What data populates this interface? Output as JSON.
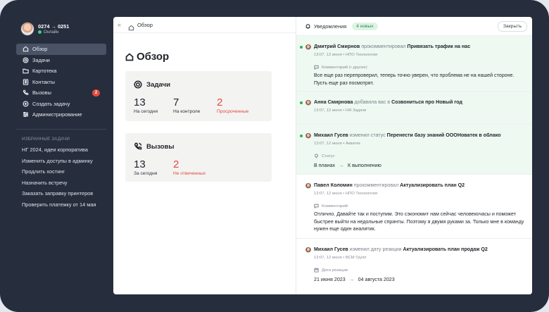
{
  "user": {
    "name": "0274 → 0251",
    "status": "Онлайн"
  },
  "nav": [
    {
      "label": "Обзор",
      "icon": "home-icon",
      "active": true
    },
    {
      "label": "Задачи",
      "icon": "target-icon"
    },
    {
      "label": "Картотека",
      "icon": "folder-icon"
    },
    {
      "label": "Контакты",
      "icon": "contacts-icon"
    },
    {
      "label": "Вызовы",
      "icon": "phone-icon",
      "badge": "2"
    },
    {
      "label": "Создать задачу",
      "icon": "plus-circle-icon"
    },
    {
      "label": "Администрирование",
      "icon": "sliders-icon"
    }
  ],
  "favorites": {
    "title": "ИЗБРАННЫЕ ЗАДАЧИ",
    "items": [
      "НГ 2024, идеи корпоратива",
      "Изменить доступы в админку",
      "Продлить хостинг",
      "Назначить встречу",
      "Заказать заправку принтеров",
      "Проверить платежку от 14 мая"
    ]
  },
  "breadcrumb": {
    "collapse": "«",
    "label": "Обзор"
  },
  "page": {
    "title": "Обзор"
  },
  "tasks": {
    "title": "Задачи",
    "stats": [
      {
        "value": "13",
        "label": "На сегодня"
      },
      {
        "value": "7",
        "label": "На контроле"
      },
      {
        "value": "2",
        "label": "Просроченные"
      }
    ]
  },
  "calls": {
    "title": "Вызовы",
    "stats": [
      {
        "value": "13",
        "label": "За сегодня"
      },
      {
        "value": "2",
        "label": "Не отвеченных"
      }
    ]
  },
  "notifications": {
    "title": "Уведомления",
    "new_badge": "4 новых",
    "close": "Закрыть",
    "items": [
      {
        "actor": "Дмитрий Смирнов",
        "verb": "прокомментировал",
        "target": "Привязать трафик на нас",
        "meta": "13:07, 12 июня • НПО Технология",
        "sub_label": "Комментарий (• другие)",
        "text": "Все еще раз перепроверил, теперь точно уверен, что проблема не на нашей стороне. Пусть еще раз посмотрят."
      },
      {
        "actor": "Анна Смирнова",
        "verb": "добавила вас в",
        "target": "Созвониться про Новый год",
        "meta": "13:07, 12 июня • НЯ Задачи"
      },
      {
        "actor": "Михаил Гусев",
        "verb": "изменил статус",
        "target": "Перенести базу знаний ОООНоватек в облако",
        "meta": "13:07, 12 июня • Акватек",
        "sub_label": "Статус",
        "from": "В планах",
        "to": "К выполнению"
      },
      {
        "actor": "Павел Коломин",
        "verb": "прокомментировал",
        "target": "Актуализировать план Q2",
        "meta": "13:07, 12 июня • НПО Технология",
        "sub_label": "Комментарий",
        "text": "Отлично. Давайте так и поступим. Это сэкономит нам сейчас человекочасы и поможет быстрее выйти на недольные спринты. Поэтому я двумя руками за. Только мне в команду нужен  еще один аналитик."
      },
      {
        "actor": "Михаил Гусев",
        "verb": "изменил дату реакции",
        "target": "Актуализировать план продаж Q2",
        "meta": "13:07, 12 июня • ВСМ Групп",
        "sub_label": "Дата реакции",
        "from": "21 июня 2023",
        "to": "04 августа 2023"
      }
    ]
  }
}
